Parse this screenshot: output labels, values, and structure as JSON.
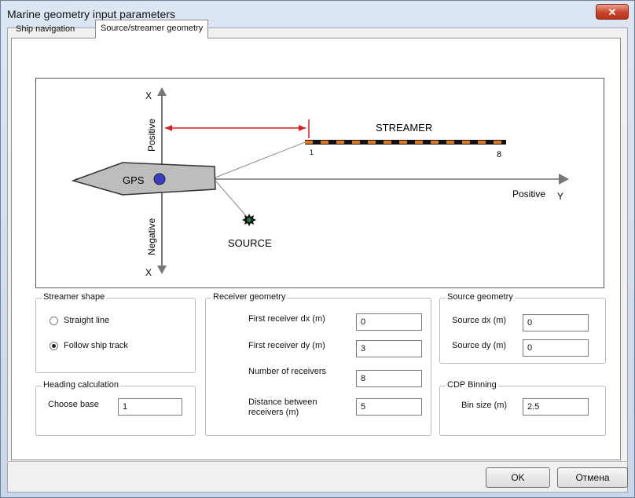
{
  "window": {
    "title": "Marine geometry input parameters",
    "close_glyph": "✕"
  },
  "tabs": [
    {
      "label": "Ship navigation",
      "active": false
    },
    {
      "label": "Source/streamer geometry",
      "active": true
    }
  ],
  "diagram": {
    "x_label": "X",
    "x_positive": "Positive",
    "x_negative": "Negative",
    "y_label": "Y",
    "y_positive": "Positive",
    "gps_label": "GPS",
    "streamer_label": "STREAMER",
    "streamer_first": "1",
    "streamer_last": "8",
    "source_label": "SOURCE"
  },
  "streamer_shape": {
    "legend": "Streamer shape",
    "options": [
      {
        "label": "Straight line",
        "selected": false
      },
      {
        "label": "Follow ship track",
        "selected": true
      }
    ]
  },
  "heading_calc": {
    "legend": "Heading calculation",
    "choose_base_label": "Choose base",
    "choose_base_value": "1"
  },
  "receiver_geometry": {
    "legend": "Receiver geometry",
    "fields": [
      {
        "label": "First receiver dx (m)",
        "value": "0"
      },
      {
        "label": "First receiver dy (m)",
        "value": "3"
      },
      {
        "label": "Number of receivers",
        "value": "8"
      },
      {
        "label": "Distance between receivers (m)",
        "value": "5"
      }
    ]
  },
  "source_geometry": {
    "legend": "Source geometry",
    "fields": [
      {
        "label": "Source dx (m)",
        "value": "0"
      },
      {
        "label": "Source dy (m)",
        "value": "0"
      }
    ]
  },
  "cdp_binning": {
    "legend": "CDP Binning",
    "bin_size_label": "Bin size (m)",
    "bin_size_value": "2.5"
  },
  "buttons": {
    "ok": "OK",
    "cancel": "Отмена"
  },
  "colors": {
    "streamer_dash": "#e07a1e",
    "arrow_red": "#d21f1f",
    "gps_dot": "#3b3bc4",
    "source_dot": "#1f7a3a"
  }
}
